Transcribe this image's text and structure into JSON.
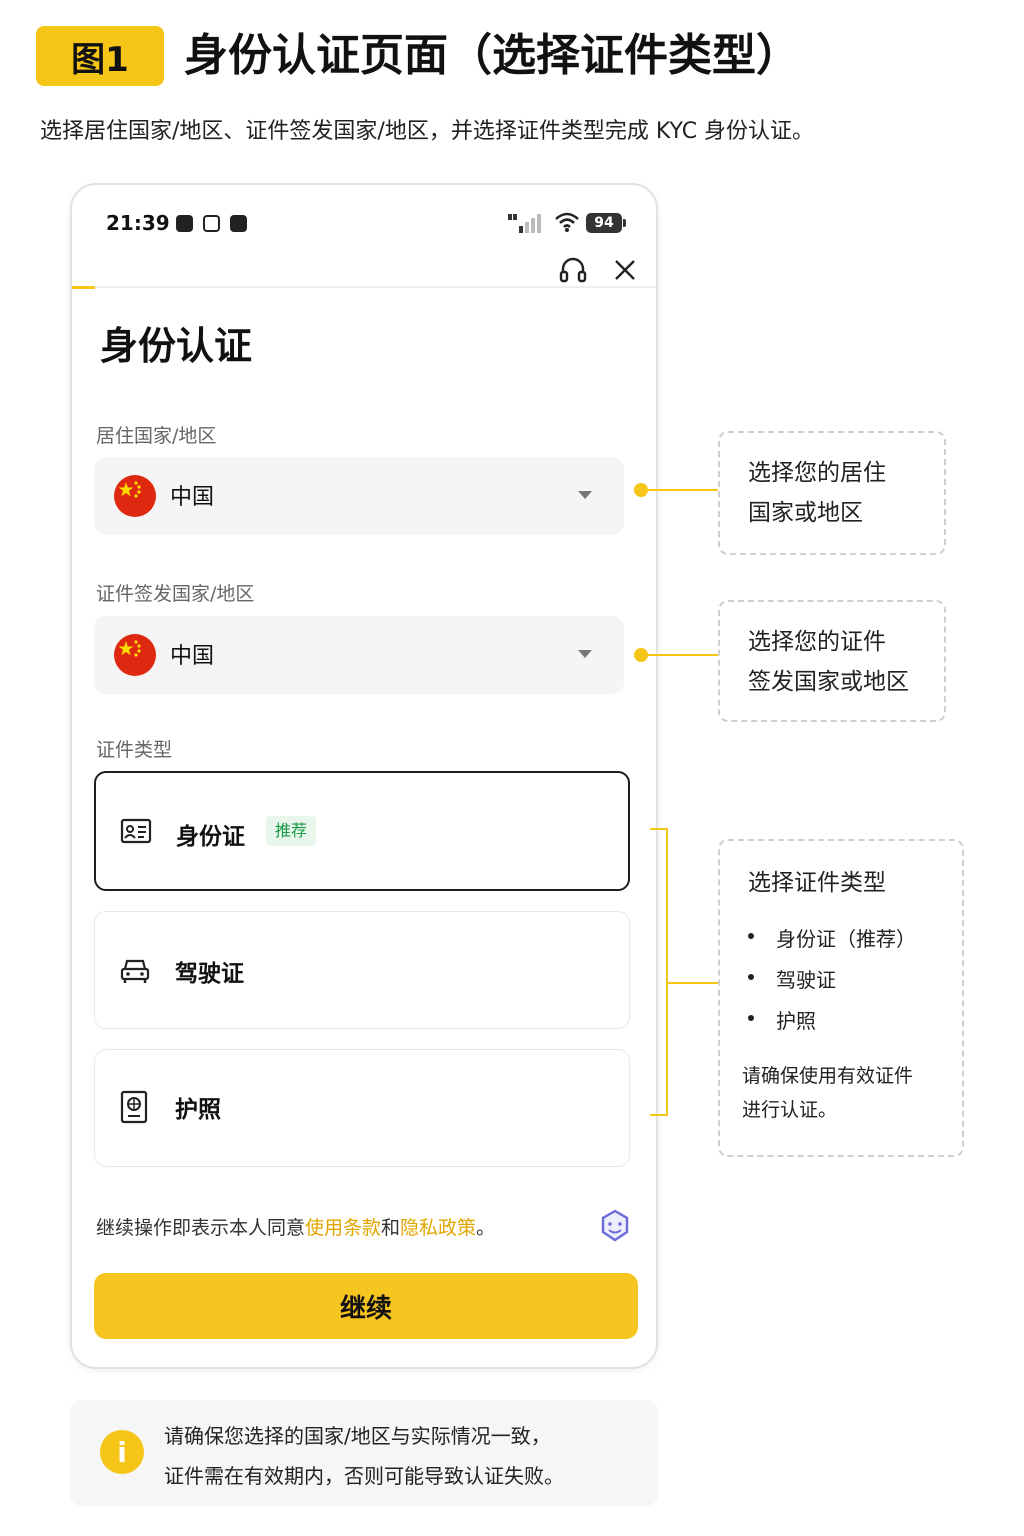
{
  "figure": {
    "badge": "图1",
    "title": "身份认证页面（选择证件类型）",
    "subtitle": "选择居住国家/地区、证件签发国家/地区，并选择证件类型完成 KYC 身份认证。"
  },
  "status_bar": {
    "time": "21:39",
    "battery": "94"
  },
  "progress": {
    "fraction": 0.04
  },
  "page": {
    "title": "身份认证",
    "residence": {
      "label": "居住国家/地区",
      "value": "中国"
    },
    "issuing": {
      "label": "证件签发国家/地区",
      "value": "中国"
    },
    "doc_type_label": "证件类型",
    "doc_types": [
      {
        "label": "身份证",
        "badge": "推荐",
        "selected": true,
        "icon": "id-card-icon"
      },
      {
        "label": "驾驶证",
        "badge": "",
        "selected": false,
        "icon": "car-icon"
      },
      {
        "label": "护照",
        "badge": "",
        "selected": false,
        "icon": "passport-icon"
      }
    ],
    "agreement": {
      "prefix": "继续操作即表示本人同意",
      "terms": "使用条款",
      "and": "和",
      "privacy": "隐私政策",
      "suffix": "。"
    },
    "continue_button": "继续"
  },
  "notice": {
    "line1": "请确保您选择的国家/地区与实际情况一致，",
    "line2": "证件需在有效期内，否则可能导致认证失败。"
  },
  "callouts": {
    "residence": {
      "line1": "选择您的居住",
      "line2": "国家或地区"
    },
    "issuing": {
      "line1": "选择您的证件",
      "line2": "签发国家或地区"
    },
    "doc": {
      "title": "选择证件类型",
      "items": [
        "身份证（推荐）",
        "驾驶证",
        "护照"
      ],
      "note_line1": "请确保使用有效证件",
      "note_line2": "进行认证。"
    }
  },
  "colors": {
    "accent": "#f5c518",
    "link": "#e2a600",
    "badge_green": "#1b9a47",
    "flag_red": "#de2910"
  }
}
